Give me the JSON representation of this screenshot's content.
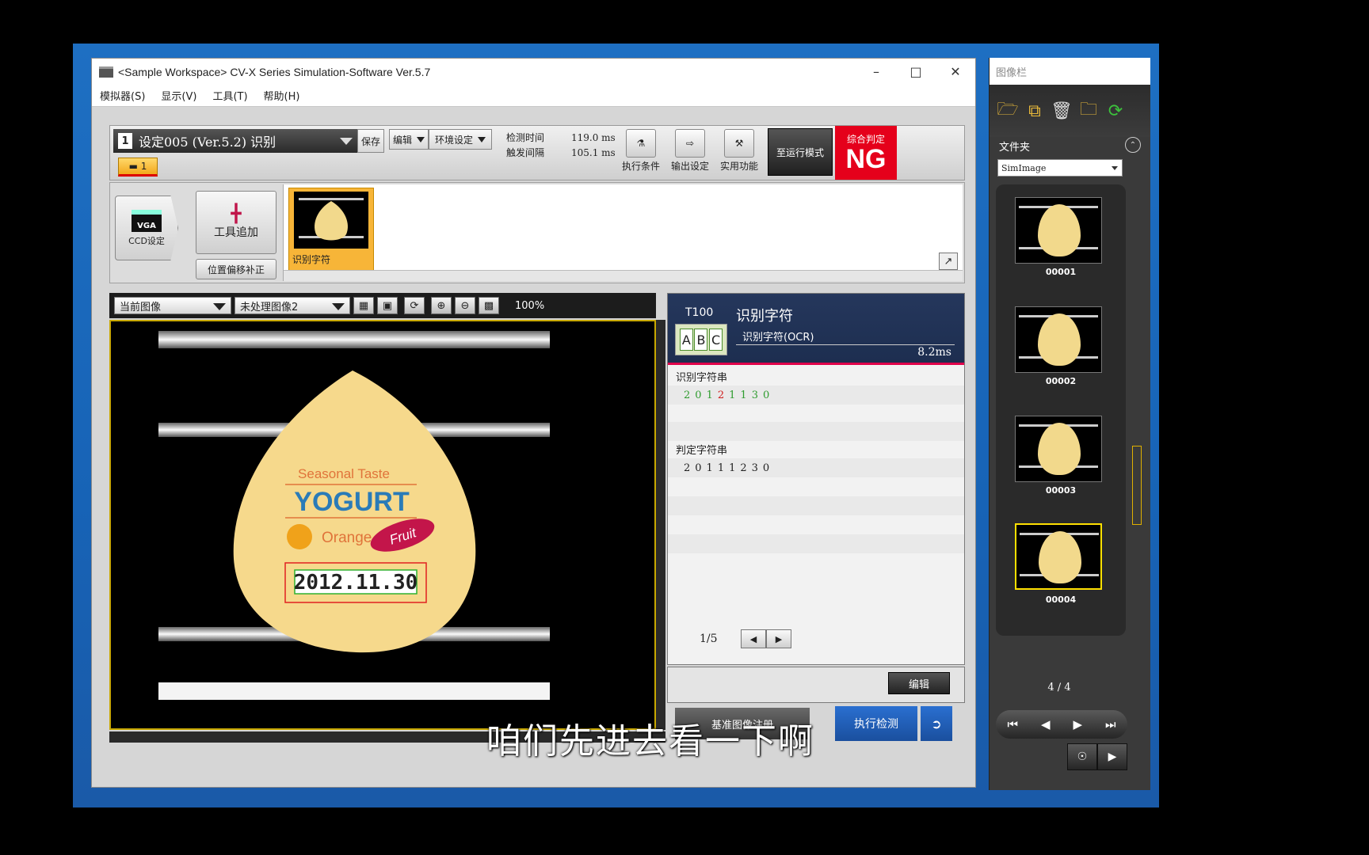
{
  "window": {
    "title": "<Sample Workspace> CV-X Series Simulation-Software Ver.5.7",
    "min": "–",
    "max": "□",
    "close": "✕"
  },
  "menu": [
    "模拟器(S)",
    "显示(V)",
    "工具(T)",
    "帮助(H)"
  ],
  "toolbar": {
    "setting_num": "1",
    "setting_name": "设定005 (Ver.5.2) 识别",
    "save": "保存",
    "edit": "编辑",
    "env": "环境设定",
    "tab_label": "1",
    "timing": [
      {
        "k": "检测时间",
        "v": "119.0 ms"
      },
      {
        "k": "触发间隔",
        "v": "105.1 ms"
      }
    ],
    "exec_cond": "执行条件",
    "output_set": "输出设定",
    "util": "实用功能",
    "run_mode": "至运行模式",
    "judge_label": "综合判定",
    "judge_value": "NG",
    "judge_color": "#e5001b"
  },
  "flow": {
    "ccd_vga": "VGA",
    "ccd_label": "CCD设定",
    "add_tool": "工具追加",
    "pos_offset": "位置偏移补正",
    "tool_name": "识别字符"
  },
  "view": {
    "source": "当前图像",
    "image_type": "未处理图像2",
    "zoom": "100%"
  },
  "image": {
    "tagline": "Seasonal Taste",
    "brand": "YOGURT",
    "flavor": "Orange",
    "badge": "Fruit",
    "date": "2012.11.30"
  },
  "result": {
    "tool_id": "T100",
    "abc": [
      "A",
      "B",
      "C"
    ],
    "tool_name": "识别字符",
    "tool_sub": "识别字符(OCR)",
    "time": "8.2ms",
    "read_label": "识别字符串",
    "read_chars": [
      {
        "c": "2",
        "ok": true
      },
      {
        "c": "0",
        "ok": true
      },
      {
        "c": "1",
        "ok": true
      },
      {
        "c": "2",
        "ok": false
      },
      {
        "c": "1",
        "ok": true
      },
      {
        "c": "1",
        "ok": true
      },
      {
        "c": "3",
        "ok": true
      },
      {
        "c": "0",
        "ok": true
      }
    ],
    "judge_label": "判定字符串",
    "judge_str": "20111230",
    "page": "1/5",
    "edit": "编辑",
    "register": "基准图像注册",
    "run": "执行检测"
  },
  "strip": {
    "title": "图像栏",
    "folder_label": "文件夹",
    "folder": "SimImage",
    "items": [
      "00001",
      "00002",
      "00003",
      "00004"
    ],
    "selected_index": 3,
    "count": "4 / 4"
  },
  "subtitle": "咱们先进去看一下啊"
}
